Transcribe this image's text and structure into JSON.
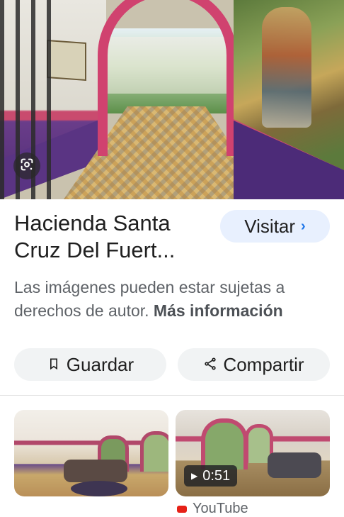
{
  "result": {
    "title": "Hacienda Santa Cruz Del Fuert...",
    "visit_label": "Visitar",
    "copyright_text": "Las imágenes pueden estar sujetas a derechos de autor.",
    "more_info_label": "Más información"
  },
  "actions": {
    "save_label": "Guardar",
    "share_label": "Compartir"
  },
  "related": {
    "video_duration": "0:51",
    "video_source": "YouTube"
  },
  "icons": {
    "lens": "google-lens-icon",
    "visit_chevron": "chevron-right-icon",
    "save": "bookmark-icon",
    "share": "share-icon",
    "play": "play-icon",
    "source": "youtube-icon"
  },
  "colors": {
    "visit_bg": "#e8f0fe",
    "accent": "#1a73e8",
    "chip_bg": "#f1f3f4"
  }
}
